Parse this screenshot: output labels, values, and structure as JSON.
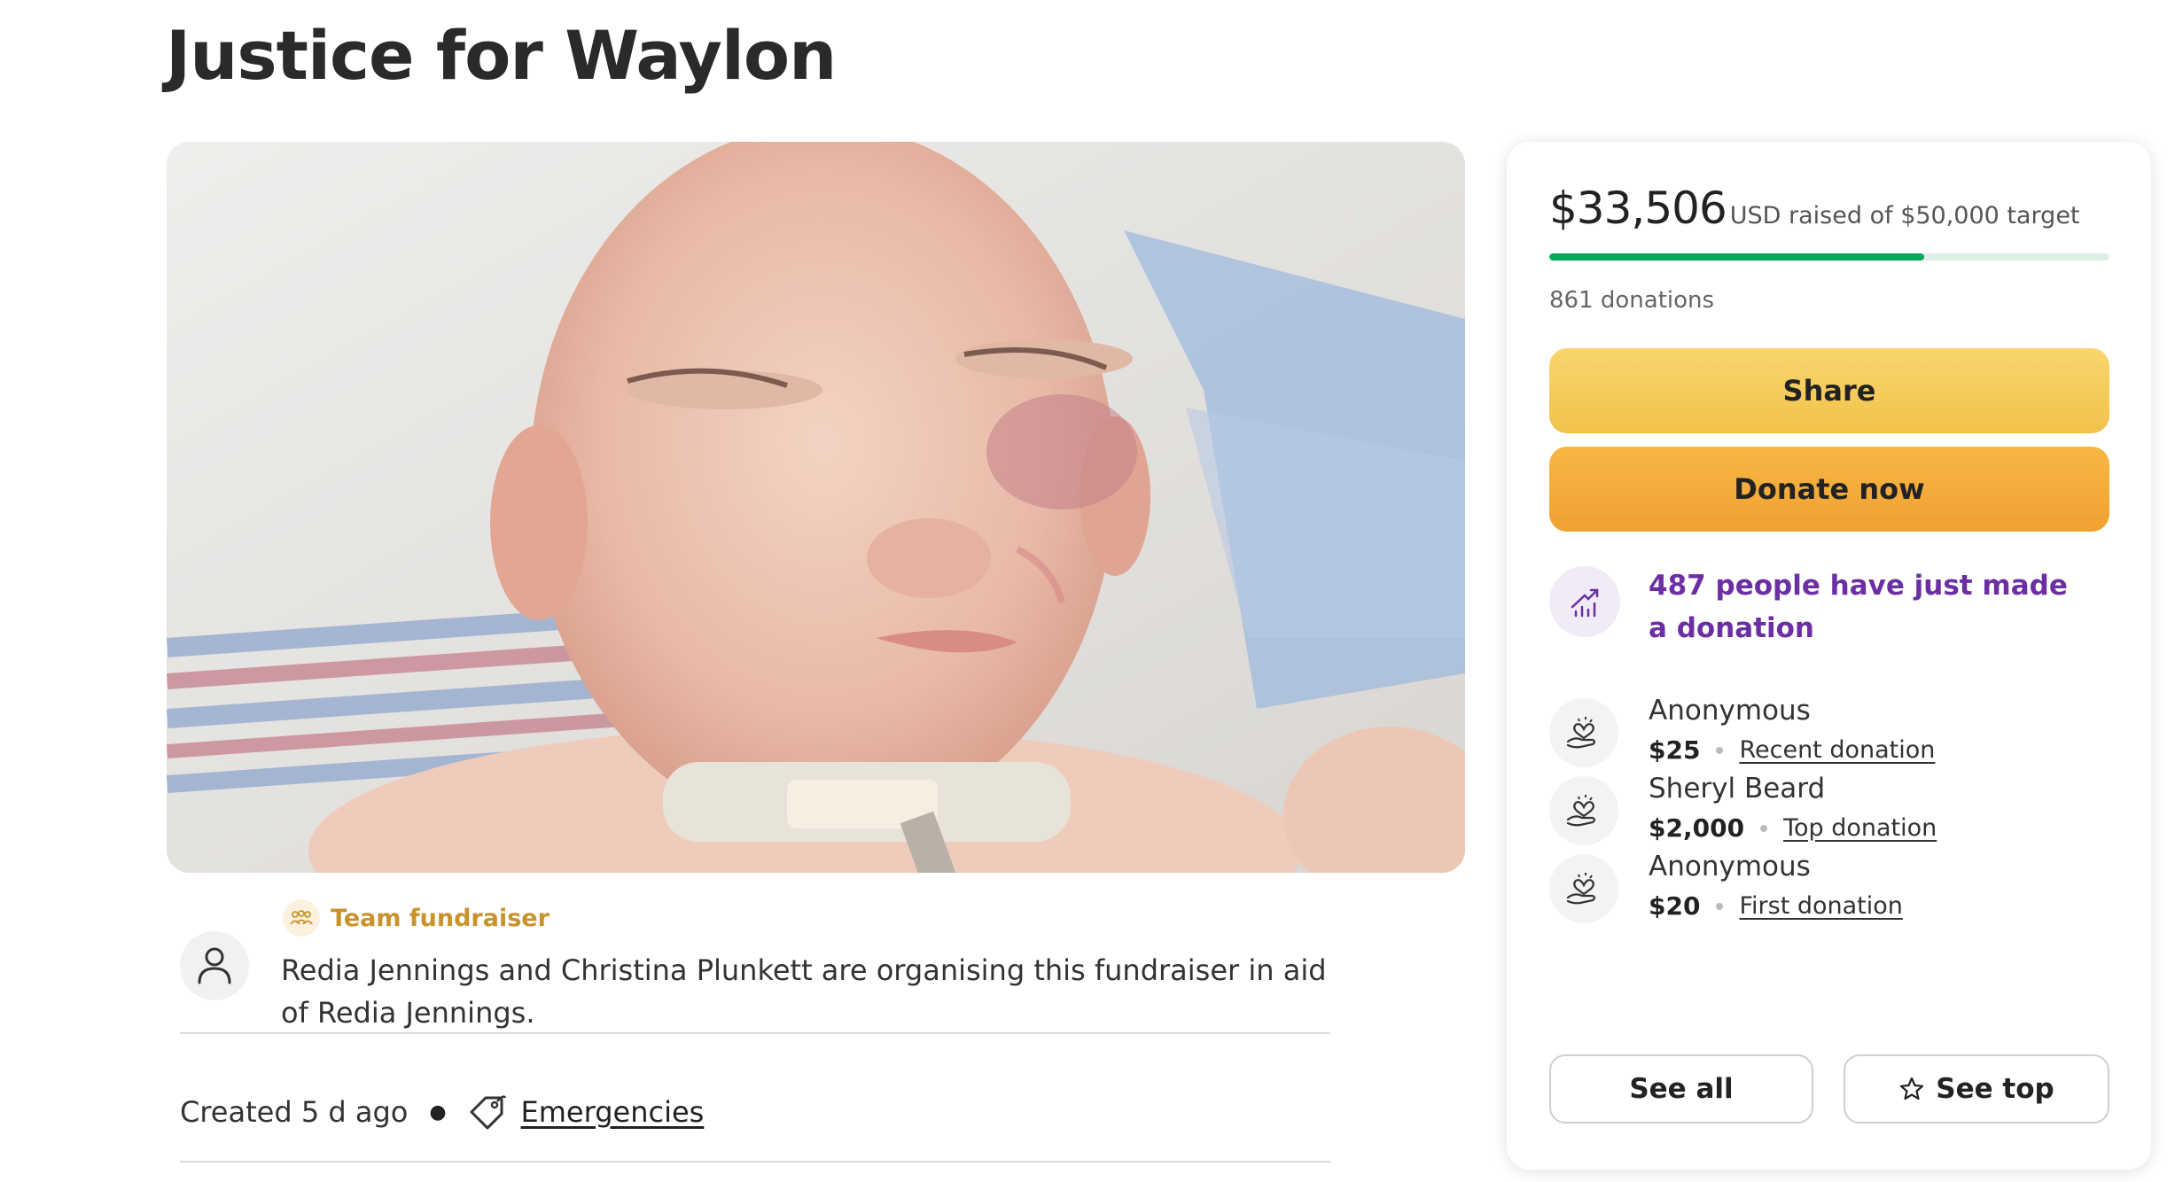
{
  "page": {
    "title": "Justice for Waylon"
  },
  "organiser": {
    "badge_label": "Team fundraiser",
    "description": "Redia Jennings and Christina Plunkett are organising this fundraiser in aid of Redia Jennings."
  },
  "meta": {
    "created": "Created 5 d ago",
    "category": "Emergencies"
  },
  "donation_card": {
    "raised_amount": "$33,506",
    "raised_suffix": "USD raised of $50,000 target",
    "progress_fraction": 0.67,
    "donation_count": "861 donations",
    "share_label": "Share",
    "donate_label": "Donate now",
    "trend_text": "487 people have just made a donation",
    "donors": [
      {
        "name": "Anonymous",
        "amount": "$25",
        "label": "Recent donation"
      },
      {
        "name": "Sheryl Beard",
        "amount": "$2,000",
        "label": "Top donation"
      },
      {
        "name": "Anonymous",
        "amount": "$20",
        "label": "First donation"
      }
    ],
    "see_all_label": "See all",
    "see_top_label": "See top"
  },
  "colors": {
    "accent_green": "#02a95c",
    "share_yellow": "#f4cc5a",
    "donate_orange": "#f3aa3a",
    "trend_purple": "#6c2ea3",
    "team_gold": "#c9932c"
  },
  "icons": {
    "avatar": "person-icon",
    "team": "team-icon",
    "tag": "tag-icon",
    "trend": "trending-up-icon",
    "donor": "heart-hand-icon",
    "star": "star-icon"
  }
}
